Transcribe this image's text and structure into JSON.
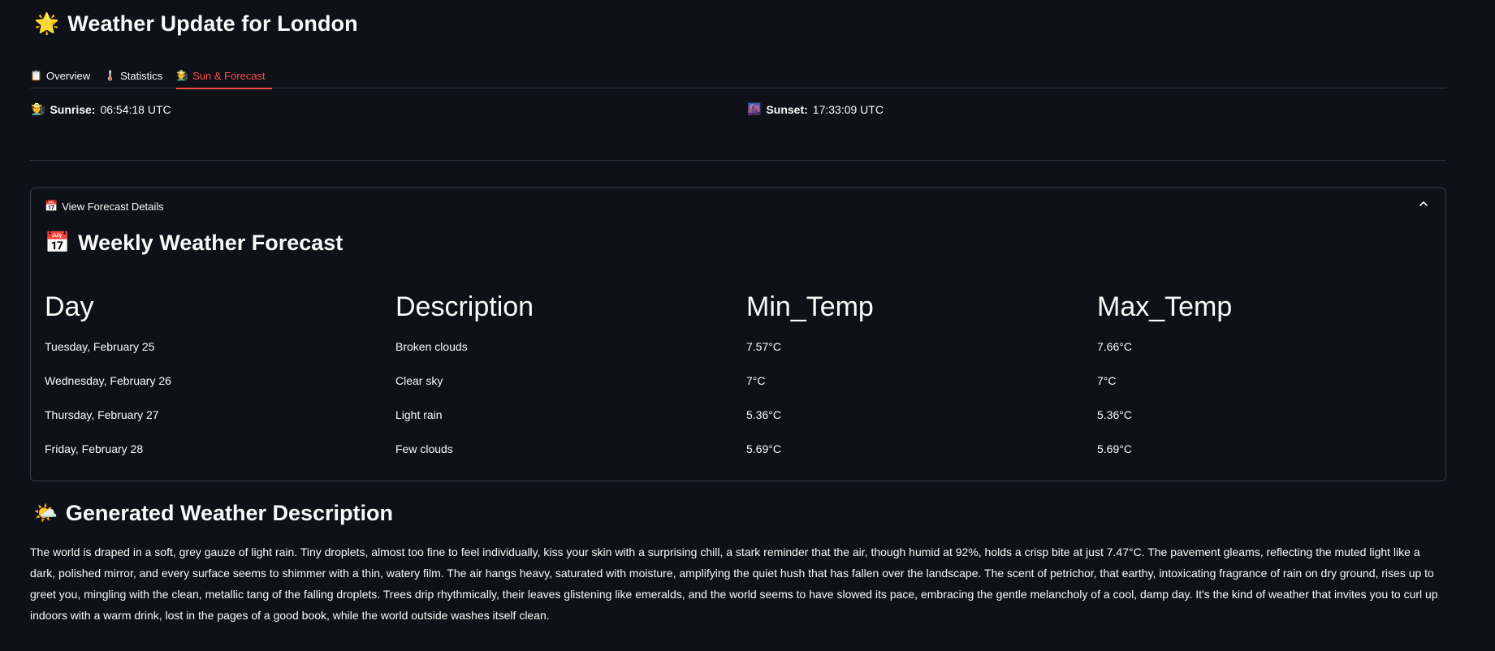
{
  "header": {
    "icon": "star-icon",
    "title": "Weather Update for London"
  },
  "tabs": [
    {
      "icon": "clipboard-icon",
      "label": "Overview",
      "active": false
    },
    {
      "icon": "thermometer-icon",
      "label": "Statistics",
      "active": false
    },
    {
      "icon": "person-sun-icon",
      "label": "Sun & Forecast",
      "active": true
    }
  ],
  "sun": {
    "sunrise": {
      "icon": "sunrise-icon",
      "label": "Sunrise:",
      "value": "06:54:18 UTC"
    },
    "sunset": {
      "icon": "sunset-icon",
      "label": "Sunset:",
      "value": "17:33:09 UTC"
    }
  },
  "expander": {
    "icon": "calendar-icon",
    "label": "View Forecast Details",
    "expanded": true,
    "title_icon": "calendar-icon",
    "title": "Weekly Weather Forecast"
  },
  "forecast": {
    "columns": [
      "Day",
      "Description",
      "Min_Temp",
      "Max_Temp"
    ],
    "rows": [
      [
        "Tuesday, February 25",
        "Broken clouds",
        "7.57°C",
        "7.66°C"
      ],
      [
        "Wednesday, February 26",
        "Clear sky",
        "7°C",
        "7°C"
      ],
      [
        "Thursday, February 27",
        "Light rain",
        "5.36°C",
        "5.36°C"
      ],
      [
        "Friday, February 28",
        "Few clouds",
        "5.69°C",
        "5.69°C"
      ]
    ]
  },
  "generated": {
    "icon": "sun-cloud-icon",
    "title": "Generated Weather Description",
    "text": "The world is draped in a soft, grey gauze of light rain. Tiny droplets, almost too fine to feel individually, kiss your skin with a surprising chill, a stark reminder that the air, though humid at 92%, holds a crisp bite at just 7.47°C. The pavement gleams, reflecting the muted light like a dark, polished mirror, and every surface seems to shimmer with a thin, watery film. The air hangs heavy, saturated with moisture, amplifying the quiet hush that has fallen over the landscape. The scent of petrichor, that earthy, intoxicating fragrance of rain on dry ground, rises up to greet you, mingling with the clean, metallic tang of the falling droplets. Trees drip rhythmically, their leaves glistening like emeralds, and the world seems to have slowed its pace, embracing the gentle melancholy of a cool, damp day. It's the kind of weather that invites you to curl up indoors with a warm drink, lost in the pages of a good book, while the world outside washes itself clean."
  },
  "colors": {
    "background": "#0e1117",
    "accent": "#ff4b4b",
    "border": "#31333f",
    "text": "#fafafa"
  }
}
